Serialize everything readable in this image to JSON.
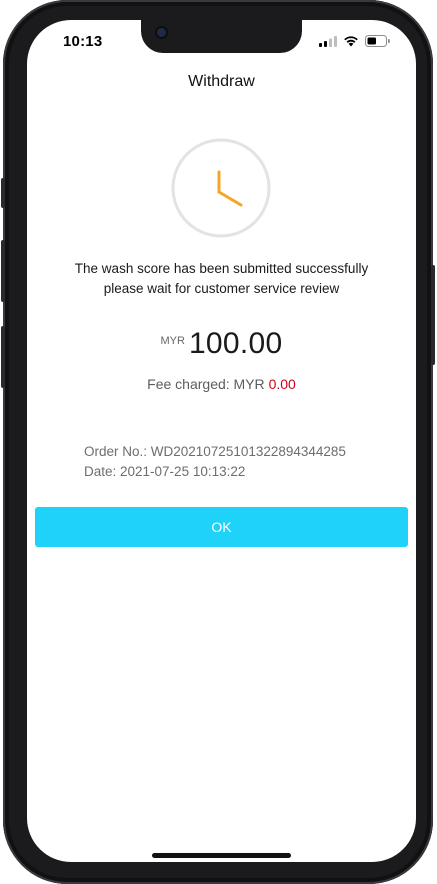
{
  "status_bar": {
    "time": "10:13",
    "icons": [
      "signal-icon",
      "wifi-icon",
      "battery-icon"
    ]
  },
  "header": {
    "title": "Withdraw"
  },
  "status_icon": "clock-icon",
  "colors": {
    "accent": "#1ed3f7",
    "clock_hands": "#f5a623",
    "clock_ring": "#e3e3e6",
    "fee_value": "#d0021b"
  },
  "message": {
    "line1": "The wash score has been submitted successfully",
    "line2": "please wait for customer service review"
  },
  "amount": {
    "currency": "MYR",
    "value": "100.00"
  },
  "fee": {
    "label": "Fee charged: MYR",
    "value": "0.00"
  },
  "order": {
    "number_line": "Order No.: WD20210725101322894344285",
    "date_line": "Date: 2021-07-25 10:13:22"
  },
  "actions": {
    "ok_label": "OK"
  }
}
